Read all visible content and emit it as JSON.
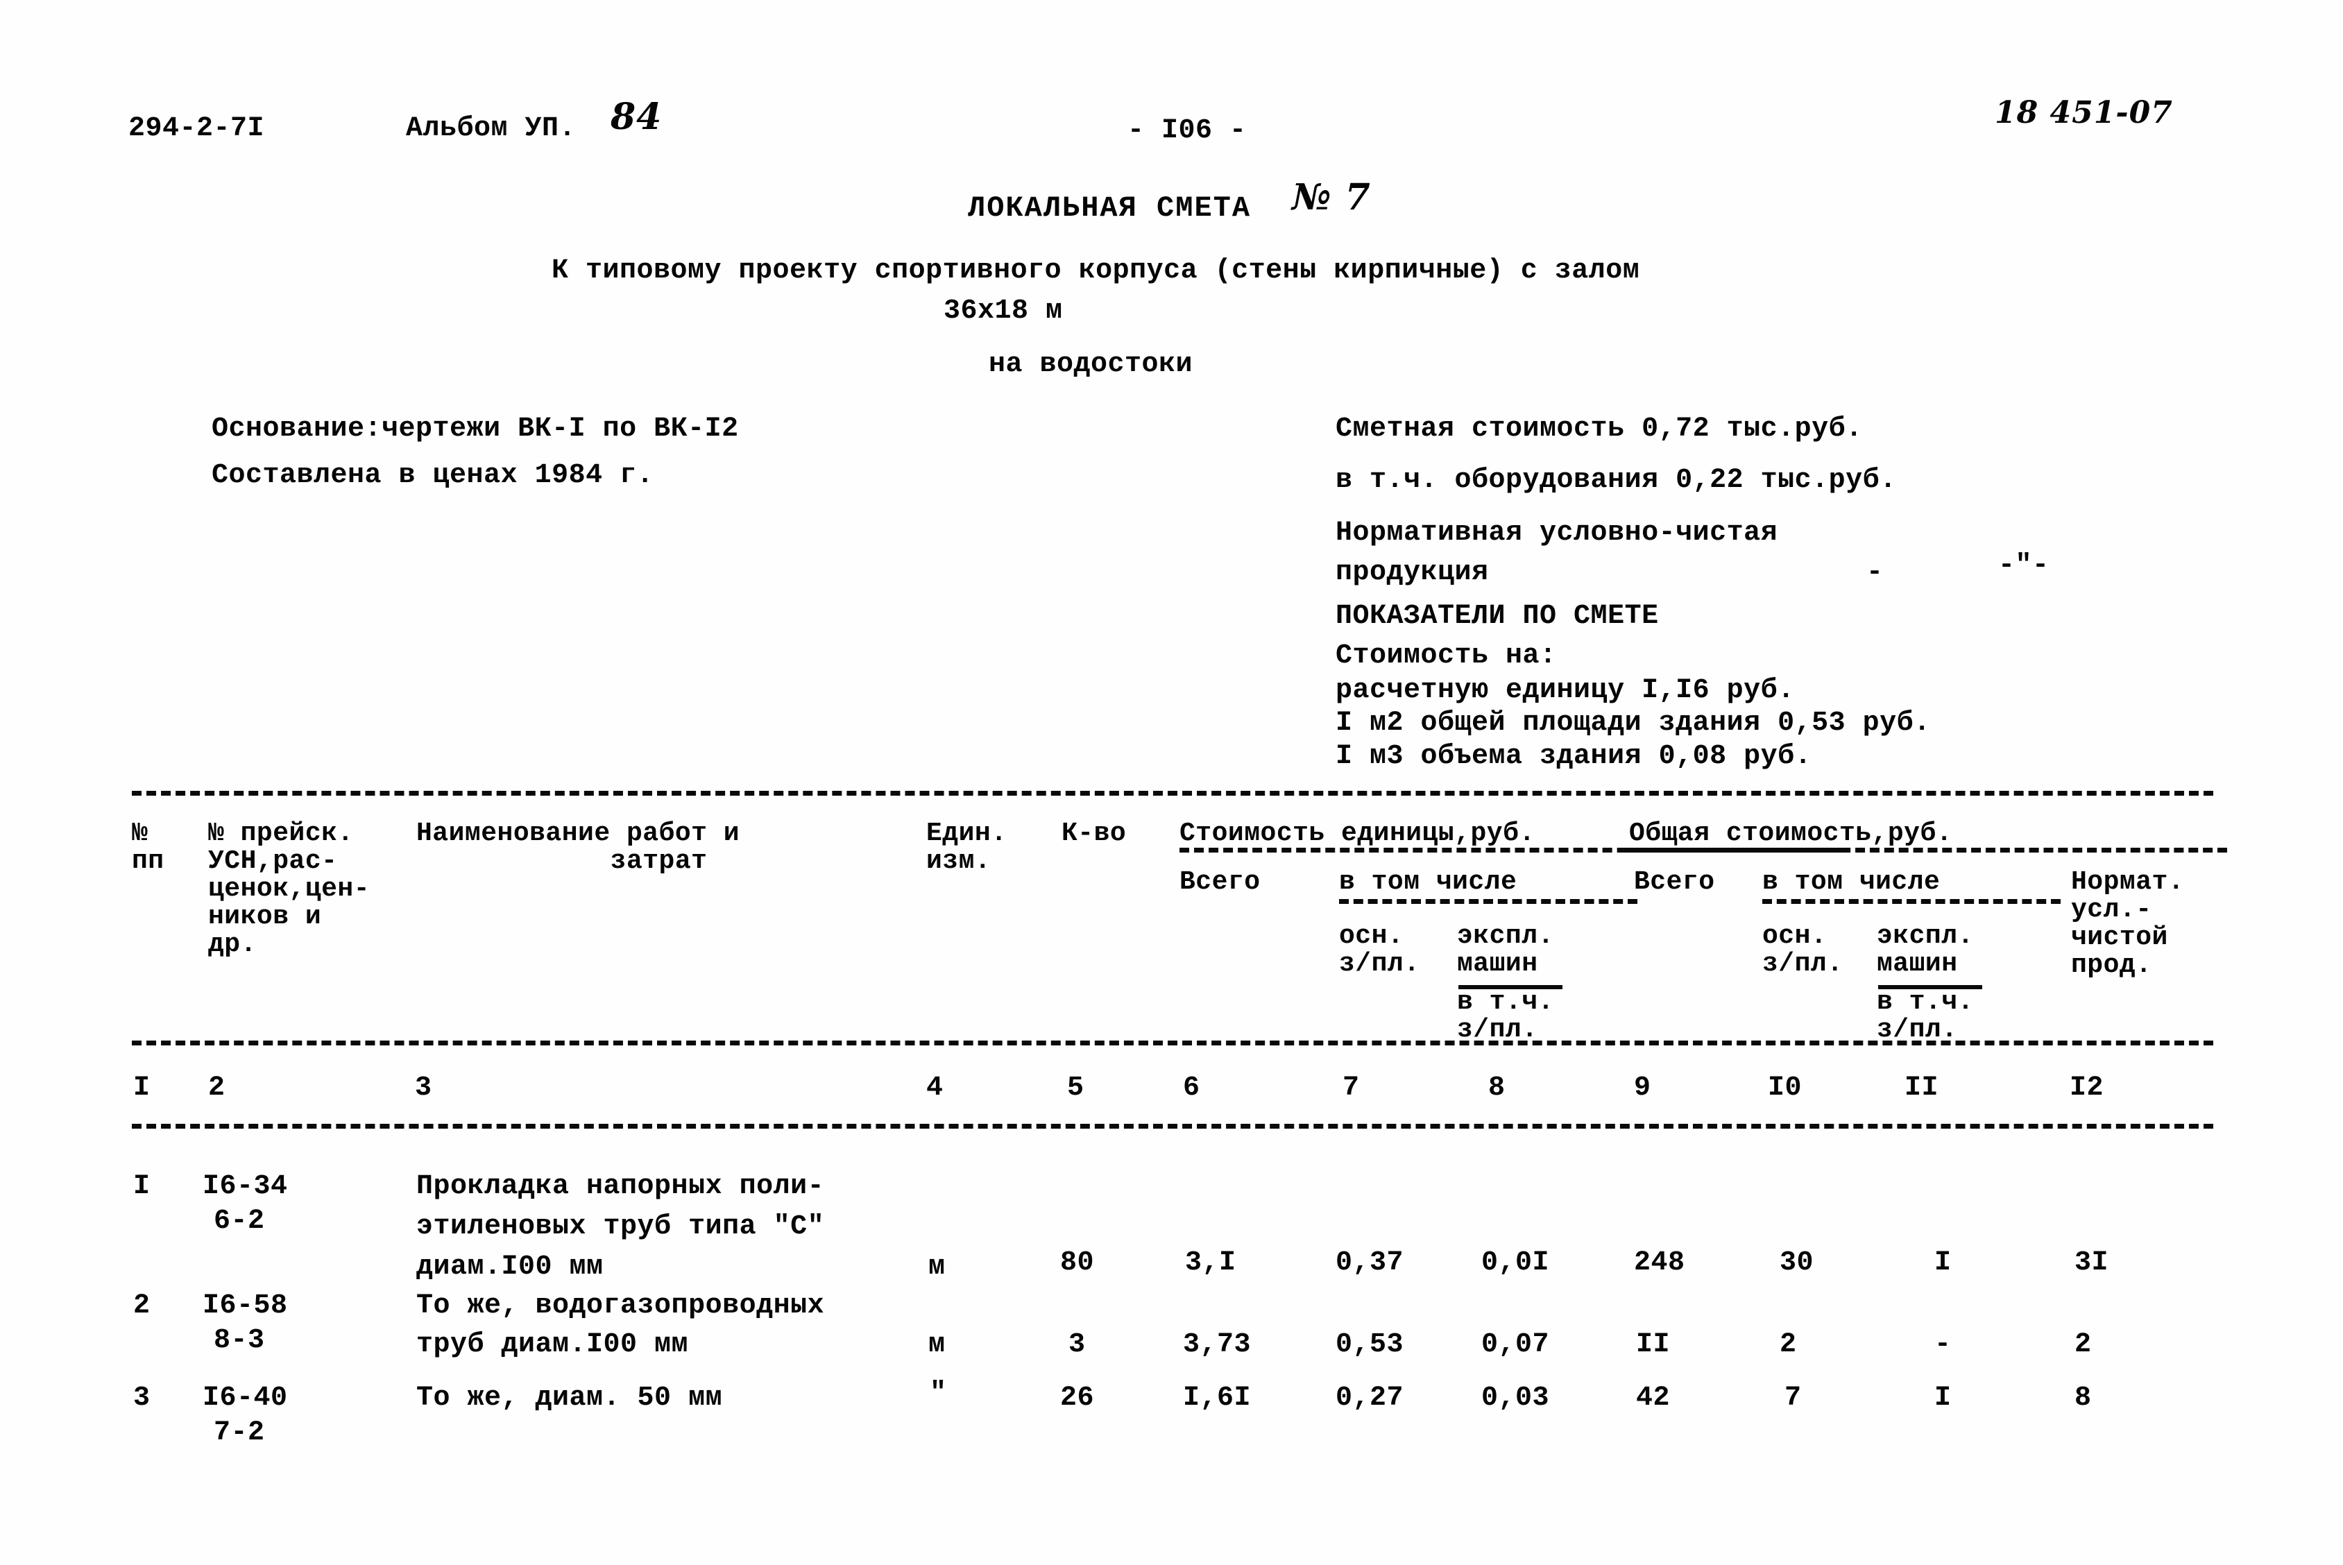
{
  "header": {
    "doc_code": "294-2-7I",
    "album_label": "Альбом УП.",
    "album_number": "84",
    "page_number": "- I06 -",
    "doc_ref": "18 451-07"
  },
  "title": {
    "main": "ЛОКАЛЬНАЯ СМЕТА",
    "number": "№ 7",
    "subtitle_1": "К типовому проекту спортивного корпуса (стены кирпичные) с залом",
    "subtitle_2": "36х18 м",
    "subtitle_3": "на водостоки"
  },
  "left_meta": {
    "basis": "Основание:чертежи ВК-I по ВК-I2",
    "prices": "Составлена в ценах 1984 г."
  },
  "right_meta": {
    "cost_total": "Сметная стоимость 0,72 тыс.руб.",
    "cost_equipment": "в т.ч. оборудования 0,22 тыс.руб.",
    "npp_line1": "Нормативная условно-чистая",
    "npp_line2": "продукция",
    "npp_dash1": "-",
    "npp_dash2": "-\"-",
    "indicators_title": "ПОКАЗАТЕЛИ ПО СМЕТЕ",
    "cost_on": "Стоимость на:",
    "cost_unit": "расчетную единицу I,I6 руб.",
    "cost_m2": "I м2 общей площади здания 0,53 руб.",
    "cost_m3": "I м3 объема здания 0,08 руб."
  },
  "table": {
    "headers": {
      "no": "№\nпп",
      "price_ref": "№ прейск.\nУСН,рас-\nценок,цен-\nников и\nдр.",
      "name": "Наименование работ и\n            затрат",
      "unit": "Един.\nизм.",
      "qty": "К-во",
      "cost_unit_group": "Стоимость единицы,руб.",
      "cost_total_group": "Общая стоимость,руб.",
      "unit_total": "Всего",
      "unit_vtch": "в том числе",
      "total_total": "Всего",
      "total_vtch": "в том числе",
      "unit_osn": "осн.\nз/пл.",
      "unit_mach": "экспл.\nмашин",
      "unit_vtch_zp": "в т.ч.\nз/пл.",
      "total_osn": "осн.\nз/пл.",
      "total_mach": "экспл.\nмашин",
      "total_vtch_zp": "в т.ч.\nз/пл.",
      "norm": "Нормат.\nусл.-\nчистой\nпрод."
    },
    "column_numbers": [
      "I",
      "2",
      "3",
      "4",
      "5",
      "6",
      "7",
      "8",
      "9",
      "I0",
      "II",
      "I2"
    ],
    "rows": [
      {
        "no": "I",
        "price_ref_1": "I6-34",
        "price_ref_2": "6-2",
        "name_1": "Прокладка напорных поли-",
        "name_2": "этиленовых труб типа \"С\"",
        "name_3": "диам.I00 мм",
        "unit": "м",
        "qty": "80",
        "unit_total": "3,I",
        "unit_osn": "0,37",
        "unit_mach": "0,0I",
        "total_total": "248",
        "total_osn": "30",
        "total_mach": "I",
        "norm": "3I"
      },
      {
        "no": "2",
        "price_ref_1": "I6-58",
        "price_ref_2": "8-3",
        "name_1": "То же, водогазопроводных",
        "name_2": "труб диам.I00 мм",
        "name_3": "",
        "unit": "м",
        "qty": "3",
        "unit_total": "3,73",
        "unit_osn": "0,53",
        "unit_mach": "0,07",
        "total_total": "II",
        "total_osn": "2",
        "total_mach": "-",
        "norm": "2"
      },
      {
        "no": "3",
        "price_ref_1": "I6-40",
        "price_ref_2": "7-2",
        "name_1": "То же, диам. 50 мм",
        "name_2": "",
        "name_3": "",
        "unit": "\"",
        "qty": "26",
        "unit_total": "I,6I",
        "unit_osn": "0,27",
        "unit_mach": "0,03",
        "total_total": "42",
        "total_osn": "7",
        "total_mach": "I",
        "norm": "8"
      }
    ]
  }
}
